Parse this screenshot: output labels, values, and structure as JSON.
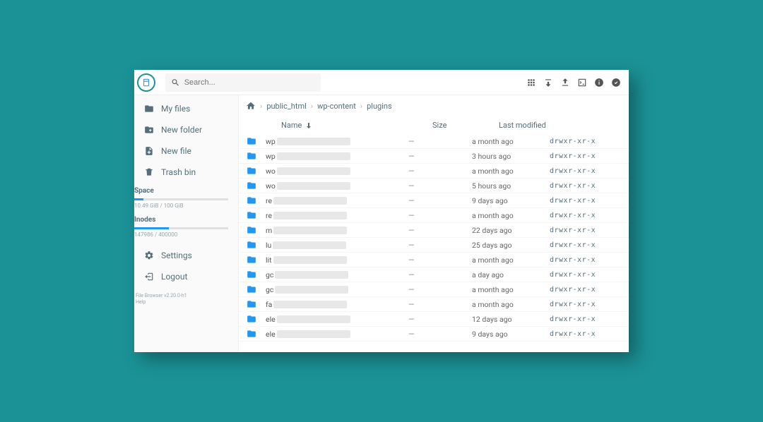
{
  "search": {
    "placeholder": "Search..."
  },
  "sidebar": {
    "items": [
      {
        "label": "My files",
        "icon": "folder"
      },
      {
        "label": "New folder",
        "icon": "create-folder"
      },
      {
        "label": "New file",
        "icon": "create-file"
      },
      {
        "label": "Trash bin",
        "icon": "trash"
      }
    ],
    "space": {
      "label": "Space",
      "text": "10.49 GiB / 100 GiB",
      "percent": 10
    },
    "inodes": {
      "label": "Inodes",
      "text": "147986 / 400000",
      "percent": 37
    },
    "settings": {
      "label": "Settings"
    },
    "logout": {
      "label": "Logout"
    },
    "footer": {
      "line1": "File Browser v2.20.0-h1",
      "line2": "Help"
    }
  },
  "breadcrumb": [
    "public_html",
    "wp-content",
    "plugins"
  ],
  "columns": {
    "name": "Name",
    "size": "Size",
    "modified": "Last modified"
  },
  "rows": [
    {
      "prefix": "wp",
      "size": "—",
      "modified": "a month ago",
      "perm": "drwxr-xr-x"
    },
    {
      "prefix": "wp",
      "size": "—",
      "modified": "3 hours ago",
      "perm": "drwxr-xr-x"
    },
    {
      "prefix": "wo",
      "size": "—",
      "modified": "a month ago",
      "perm": "drwxr-xr-x"
    },
    {
      "prefix": "wo",
      "size": "—",
      "modified": "5 hours ago",
      "perm": "drwxr-xr-x"
    },
    {
      "prefix": "re",
      "size": "—",
      "modified": "9 days ago",
      "perm": "drwxr-xr-x"
    },
    {
      "prefix": "re",
      "size": "—",
      "modified": "a month ago",
      "perm": "drwxr-xr-x"
    },
    {
      "prefix": "m",
      "size": "—",
      "modified": "22 days ago",
      "perm": "drwxr-xr-x"
    },
    {
      "prefix": "lu",
      "size": "—",
      "modified": "25 days ago",
      "perm": "drwxr-xr-x"
    },
    {
      "prefix": "lit",
      "size": "—",
      "modified": "a month ago",
      "perm": "drwxr-xr-x"
    },
    {
      "prefix": "gc",
      "size": "—",
      "modified": "a day ago",
      "perm": "drwxr-xr-x"
    },
    {
      "prefix": "gc",
      "size": "—",
      "modified": "a month ago",
      "perm": "drwxr-xr-x"
    },
    {
      "prefix": "fa",
      "size": "—",
      "modified": "a month ago",
      "perm": "drwxr-xr-x"
    },
    {
      "prefix": "ele",
      "size": "—",
      "modified": "12 days ago",
      "perm": "drwxr-xr-x"
    },
    {
      "prefix": "ele",
      "size": "—",
      "modified": "9 days ago",
      "perm": "drwxr-xr-x"
    }
  ]
}
